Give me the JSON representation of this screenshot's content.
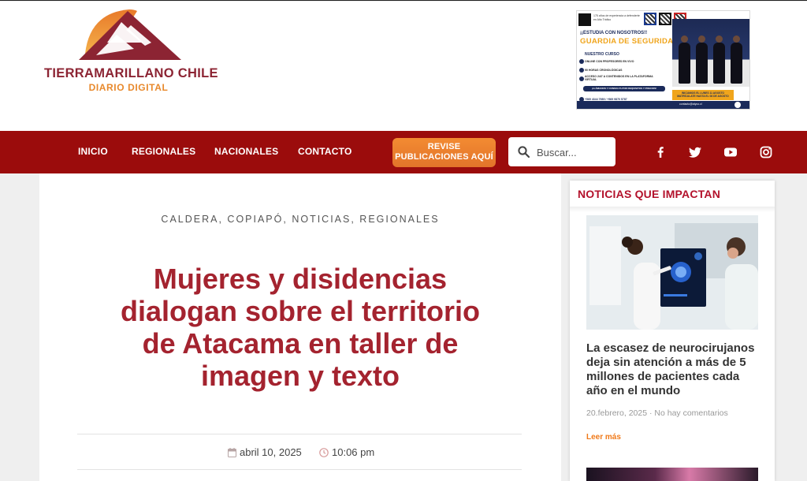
{
  "logo": {
    "title": "TIERRAMARILLANO CHILE",
    "subtitle": "DIARIO DIGITAL",
    "colors": {
      "mountain_orange": "#e8892c",
      "mountain_maroon": "#8c2433"
    }
  },
  "ad": {
    "top_text": "175 años de experiencia a defenderte en Alto Tráfico",
    "line1": "¡¡ESTUDIA CON NOSOTROS!!",
    "line2": "GUARDIA DE SEGURIDAD",
    "line3": "NUESTRO CURSO",
    "bullets": [
      "ONLINE CON PROFESORES EN VIVO",
      "90 HORAS CRONOLÓGICAS",
      "ACCESO 24/7 A CONTENIDOS EN LA PLATAFORMA VIRTUAL"
    ],
    "cta": "¡LLÁMANOS Y CONSULTA POR REQUISITOS Y PRECIOS!",
    "phone": "+569 4344 7989 / +569 9870 5787",
    "promo": "INICIAMOS EL LUNES 11 AGOSTO MATRÍCULATE HASTA EL 08 DE AGOSTO",
    "footer": "contacto@atyco.cl"
  },
  "nav": {
    "items": [
      "INICIO",
      "REGIONALES",
      "NACIONALES",
      "CONTACTO"
    ],
    "revise_button": "REVISE PUBLICACIONES AQUÍ",
    "search_placeholder": "Buscar...",
    "social_icons": [
      "facebook-icon",
      "twitter-icon",
      "youtube-icon",
      "instagram-icon"
    ],
    "bar_color": "#9b0c0c",
    "button_color": "#f38b32"
  },
  "article": {
    "categories": "CALDERA, COPIAPÓ, NOTICIAS, REGIONALES",
    "title": "Mujeres y disidencias dialogan sobre el territorio de Atacama en taller de imagen y texto",
    "date": "abril 10, 2025",
    "time": "10:06 pm",
    "title_color": "#a4232f"
  },
  "sidebar": {
    "heading": "NOTICIAS QUE IMPACTAN",
    "news": [
      {
        "title": "La escasez de neurocirujanos deja sin atención a más de 5 millones de pacientes cada año en el mundo",
        "meta": "20.febrero, 2025 · No hay comentarios",
        "more": "Leer más"
      }
    ]
  }
}
